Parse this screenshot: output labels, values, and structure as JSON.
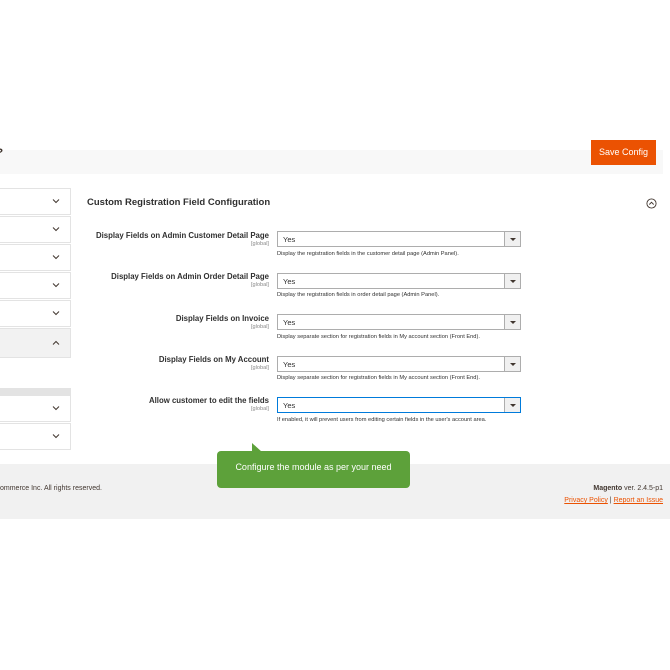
{
  "header": {
    "save_label": "Save Config"
  },
  "sidebar": {
    "items": [
      {
        "state": "collapsed"
      },
      {
        "state": "collapsed"
      },
      {
        "state": "collapsed"
      },
      {
        "state": "collapsed"
      },
      {
        "state": "collapsed"
      },
      {
        "state": "expanded"
      },
      {
        "state": "collapsed"
      },
      {
        "state": "collapsed"
      }
    ]
  },
  "section": {
    "title": "Custom Registration Field Configuration",
    "fields": [
      {
        "label": "Display Fields on Admin Customer Detail Page",
        "scope": "[global]",
        "value": "Yes",
        "note": "Display the registration fields in the customer detail page (Admin Panel)."
      },
      {
        "label": "Display Fields on Admin Order Detail Page",
        "scope": "[global]",
        "value": "Yes",
        "note": "Display the registration fields in order detail page (Admin Panel)."
      },
      {
        "label": "Display Fields on Invoice",
        "scope": "[global]",
        "value": "Yes",
        "note": "Display separate section for registration fields in My account section (Front End)."
      },
      {
        "label": "Display Fields on My Account",
        "scope": "[global]",
        "value": "Yes",
        "note": "Display separate section for registration fields in My account section (Front End)."
      },
      {
        "label": "Allow customer to edit the fields",
        "scope": "[global]",
        "value": "Yes",
        "note": "If enabled, it will prevent users from editing certain fields in the user's account area."
      }
    ]
  },
  "callout": {
    "text": "Configure the module as per your need"
  },
  "footer": {
    "copyright": "ommerce Inc. All rights reserved.",
    "brand": "Magento",
    "version": " ver. 2.4.5-p1",
    "privacy": "Privacy Policy",
    "separator": " | ",
    "report": "Report an Issue"
  },
  "colors": {
    "accent": "#eb5202",
    "callout": "#5da13a",
    "footer_bg": "#f1f1f1"
  }
}
